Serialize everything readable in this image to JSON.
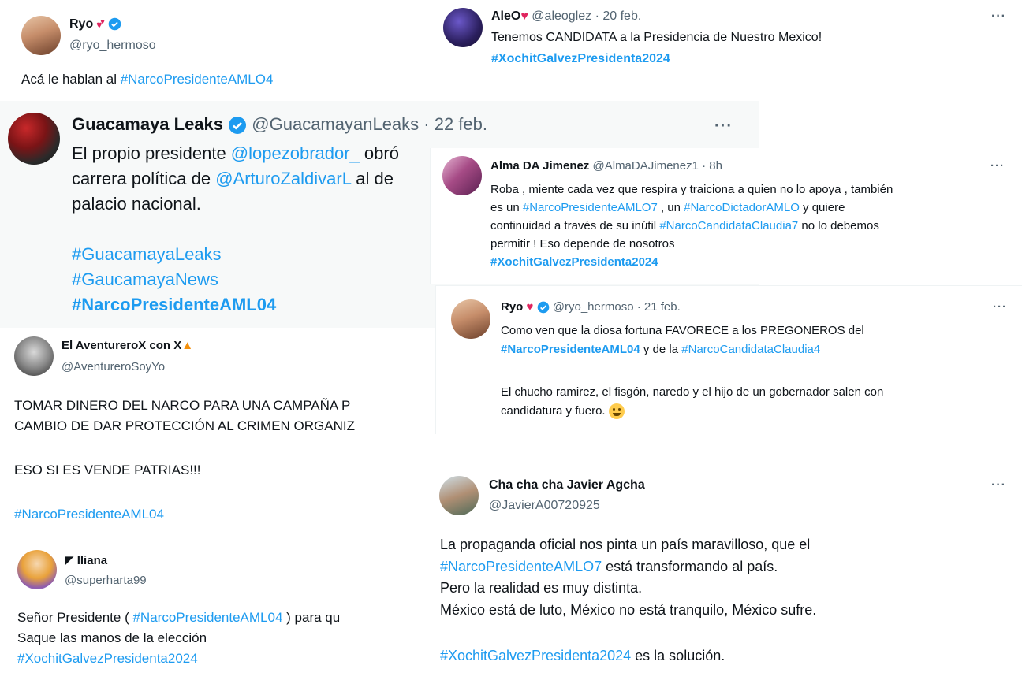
{
  "colors": {
    "link": "#1d9bf0",
    "text": "#0f1419",
    "muted": "#536471",
    "verified": "#1d9bf0"
  },
  "tweet1": {
    "name": "Ryo",
    "handle": "@ryo_hermoso",
    "text": "Acá le hablan al ",
    "tag": "#NarcoPresidenteAMLO4"
  },
  "tweet2": {
    "name": "AleO",
    "meta": "@aleoglez · 20 feb.",
    "text": "Tenemos CANDIDATA a la Presidencia de Nuestro Mexico!",
    "tag": "#XochitGalvezPresidenta2024",
    "more": "···"
  },
  "tweet3": {
    "name": "Guacamaya Leaks",
    "meta": "@GuacamayanLeaks · 22 feb.",
    "more": "···",
    "l1_a": "El propio presidente ",
    "l1_mention": "@lopezobrador_",
    "l1_b": " obró",
    "l2_a": "carrera política de ",
    "l2_mention": "@ArturoZaldivarL",
    "l2_b": " al de",
    "l3": "palacio nacional.",
    "tag1": "#GuacamayaLeaks",
    "tag2": "#GaucamayaNews",
    "tag3": "#NarcoPresidenteAML04"
  },
  "tweet4": {
    "name": "Alma DA Jimenez",
    "meta": "@AlmaDAJimenez1 · 8h",
    "more": "···",
    "l1": "Roba , miente cada vez que respira y traiciona a quien no lo apoya , también",
    "l2_a": "es un ",
    "l2_tag1": "#NarcoPresidenteAMLO7",
    "l2_b": " , un ",
    "l2_tag2": "#NarcoDictadorAMLO",
    "l2_c": " y quiere",
    "l3_a": "continuidad  a través de su inútil ",
    "l3_tag": "#NarcoCandidataClaudia7",
    "l3_b": "  no lo debemos",
    "l4": "permitir ! Eso depende de nosotros",
    "l5_tag": "#XochitGalvezPresidenta2024"
  },
  "tweet5": {
    "name": "El AventureroX con X",
    "handle": "@AventureroSoyYo",
    "l1": "TOMAR DINERO DEL NARCO PARA UNA CAMPAÑA P",
    "l2": "CAMBIO DE DAR PROTECCIÓN AL CRIMEN ORGANIZ",
    "l3": "ESO SI ES VENDE PATRIAS!!!",
    "tag": "#NarcoPresidenteAML04"
  },
  "tweet6": {
    "name": "Ryo",
    "meta": "@ryo_hermoso · 21 feb.",
    "more": "···",
    "l1": "Como ven que la diosa fortuna FAVORECE a los PREGONEROS del",
    "l2_tag1": "#NarcoPresidenteAML04",
    "l2_b": " y de la ",
    "l2_tag2": "#NarcoCandidataClaudia4",
    "l3": "El chucho ramirez, el fisgón, naredo y el hijo de un gobernador salen con",
    "l4": "candidatura y fuero. "
  },
  "tweet7": {
    "name": "Iliana",
    "handle": "@superharta99",
    "l1_a": "Señor Presidente ( ",
    "l1_tag": "#NarcoPresidenteAML04",
    "l1_b": " ) para qu",
    "l2": "Saque las manos de la elección",
    "tag": "#XochitGalvezPresidenta2024"
  },
  "tweet8": {
    "name": "Cha cha cha Javier Agcha",
    "handle": "@JavierA00720925",
    "more": "···",
    "l1": "La propaganda oficial nos pinta un país maravilloso, que el",
    "l2_tag": "#NarcoPresidenteAMLO7",
    "l2_b": "  está transformando al país.",
    "l3": "Pero la realidad es muy distinta.",
    "l4": "México está de luto, México no está tranquilo, México sufre.",
    "l5_tag": "#XochitGalvezPresidenta2024",
    "l5_b": " es la solución."
  }
}
